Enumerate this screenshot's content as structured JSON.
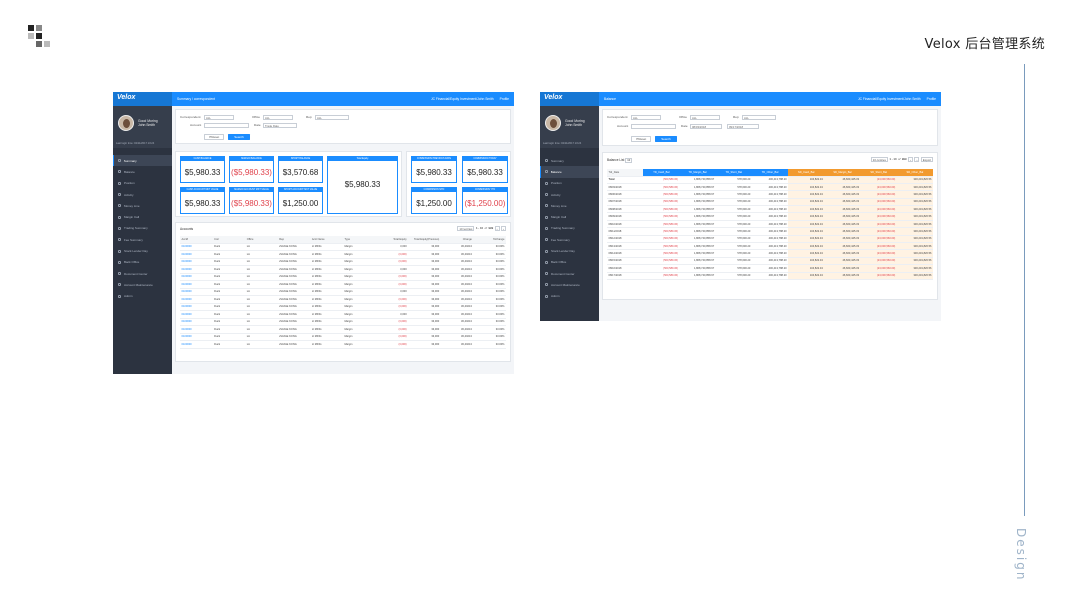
{
  "page": {
    "title": "Velox 后台管理系统",
    "side_label": "Design"
  },
  "left": {
    "brand": "Velox",
    "user": {
      "greeting": "Good Moring",
      "name": "John Smith",
      "last_login": "Last login time: 02/11/2017 13:24"
    },
    "breadcrumb": "Summary  /  correspondent",
    "account_label": "JC Financial/Equity Investment/John Smith",
    "profile_label": "Profile",
    "menu": [
      "Summary",
      "Balance",
      "Position",
      "Activity",
      "Money Line",
      "Margin Call",
      "Trading Summary",
      "Fee Summary",
      "Stock Lender Day",
      "Back Office",
      "Document Center",
      "Account Maintenance",
      "Admin"
    ],
    "filters": {
      "correspondent_label": "Correspondent",
      "correspondent_value": "ALL",
      "office_label": "Office",
      "office_value": "ALL",
      "rep_label": "Rep",
      "rep_value": "ALL",
      "account_label": "Account",
      "date_label": "Date",
      "date_value": "Trade Date",
      "reset": "Reset",
      "search": "Search"
    },
    "kpis": {
      "cash_balance": {
        "label": "CASH BALANCE",
        "value": "$5,980.33"
      },
      "margin_balance": {
        "label": "MARGIN BALANCE",
        "value": "($5,980.33)"
      },
      "short_balance": {
        "label": "SHORT BALANCE",
        "value": "$3,570.68"
      },
      "total_equity": {
        "label": "Total Equity",
        "value": "$5,980.33"
      },
      "cash_mkt": {
        "label": "CASH ACCOUNT MKT VALUE",
        "value": "$5,980.33"
      },
      "margin_mkt": {
        "label": "MARGIN ACCOUNT MKT VALUE",
        "value": "($5,980.33)"
      },
      "short_mkt": {
        "label": "SHORT ACCOUNT MKT VALUE",
        "value": "$1,250.00"
      },
      "commission_prev": {
        "label": "COMMISSION PREVIOUS DATE",
        "value": "$5,980.33"
      },
      "commission_today": {
        "label": "COMMISSION TODAY",
        "value": "$5,980.33"
      },
      "commission_a": {
        "label": "COMMISSION MTD",
        "value": "$1,250.00"
      },
      "commission_b": {
        "label": "COMMISSION YTD",
        "value": "($1,250.00)"
      }
    },
    "accounts": {
      "title": "Accounts",
      "pager": {
        "per_page": "10 /entries",
        "range": "1 - 10",
        "of": "of",
        "total": "999"
      },
      "columns": [
        "Acct#",
        "Corr",
        "Office",
        "Rep",
        "Acct Name",
        "Type",
        "Total Equity",
        "Total Equity(Previous)",
        "Change",
        "%Change"
      ],
      "rows": [
        [
          "0100000",
          "Duck",
          "LA",
          "ZHUGE KONG",
          "LI MING",
          "Margin",
          "3,000",
          "33,000",
          "30,40213",
          "33.00%"
        ],
        [
          "0100000",
          "Duck",
          "LA",
          "ZHUGE KONG",
          "LI MING",
          "Margin",
          "(3,000)",
          "33,000",
          "30,40213",
          "33.00%"
        ],
        [
          "0100000",
          "Duck",
          "LA",
          "ZHUGE KONG",
          "LI MING",
          "Margin",
          "(3,000)",
          "33,000",
          "30,40213",
          "33.00%"
        ],
        [
          "0100000",
          "Duck",
          "LA",
          "ZHUGE KONG",
          "LI MING",
          "Margin",
          "3,000",
          "33,000",
          "30,40213",
          "33.00%"
        ],
        [
          "0100000",
          "Duck",
          "LA",
          "ZHUGE KONG",
          "LI MING",
          "Margin",
          "(3,000)",
          "33,000",
          "30,40213",
          "33.00%"
        ],
        [
          "0100000",
          "Duck",
          "LA",
          "ZHUGE KONG",
          "LI MING",
          "Margin",
          "(3,000)",
          "33,000",
          "30,40213",
          "33.00%"
        ],
        [
          "0100000",
          "Duck",
          "LA",
          "ZHUGE KONG",
          "LI MING",
          "Margin",
          "3,000",
          "33,000",
          "30,40213",
          "33.00%"
        ],
        [
          "0100000",
          "Duck",
          "LA",
          "ZHUGE KONG",
          "LI MING",
          "Margin",
          "(3,000)",
          "33,000",
          "30,40213",
          "33.00%"
        ],
        [
          "0100000",
          "Duck",
          "LA",
          "ZHUGE KONG",
          "LI MING",
          "Margin",
          "(3,000)",
          "33,000",
          "30,40213",
          "33.00%"
        ],
        [
          "0100000",
          "Duck",
          "LA",
          "ZHUGE KONG",
          "LI MING",
          "Margin",
          "3,000",
          "33,000",
          "30,40213",
          "33.00%"
        ],
        [
          "0100000",
          "Duck",
          "LA",
          "ZHUGE KONG",
          "LI MING",
          "Margin",
          "(3,000)",
          "33,000",
          "30,40213",
          "33.00%"
        ],
        [
          "0100000",
          "Duck",
          "LA",
          "ZHUGE KONG",
          "LI MING",
          "Margin",
          "(3,000)",
          "33,000",
          "30,40213",
          "33.00%"
        ],
        [
          "0100000",
          "Duck",
          "LA",
          "ZHUGE KONG",
          "LI MING",
          "Margin",
          "(3,000)",
          "33,000",
          "30,40213",
          "33.00%"
        ],
        [
          "0100000",
          "Duck",
          "LA",
          "ZHUGE KONG",
          "LI MING",
          "Margin",
          "(3,000)",
          "33,000",
          "30,40213",
          "33.00%"
        ]
      ]
    }
  },
  "right": {
    "brand": "Velox",
    "user": {
      "greeting": "Good Moring",
      "name": "John Smith",
      "last_login": "Last login time: 02/11/2017 13:24"
    },
    "breadcrumb": "Balance",
    "account_label": "JC Financial/Equity Investment/John Smith",
    "profile_label": "Profile",
    "menu": [
      "Summary",
      "Balance",
      "Position",
      "Activity",
      "Money Line",
      "Margin Call",
      "Trading Summary",
      "Fee Summary",
      "Stock Lender Day",
      "Back Office",
      "Document Center",
      "Account Maintenance",
      "Admin"
    ],
    "filters": {
      "correspondent_label": "Correspondent",
      "correspondent_value": "ALL",
      "office_label": "Office",
      "office_value": "ALL",
      "rep_label": "Rep",
      "rep_value": "ALL",
      "account_label": "Account",
      "date_label": "Date",
      "date_from": "08/03/2018",
      "date_to": "09/17/2018",
      "reset": "Reset",
      "search": "Search"
    },
    "balance": {
      "title": "Balance List",
      "badge": "10",
      "pager": {
        "per_page": "10 /entries",
        "range": "1 - 10",
        "of": "of",
        "total": "999"
      },
      "export": "Export",
      "columns": [
        "Ttd_Date",
        "TD_Cash_Bal",
        "TD_Margin_Bal",
        "TD_Short_Bal",
        "TD_Other_Bal",
        "SD_Cash_Bal",
        "SD_Margin_Bal",
        "SD_Short_Bal",
        "SD_Other_Bal"
      ],
      "rows": [
        [
          "Total",
          "(560,589.36)",
          "1,868,740,858.97",
          "578,600.20",
          "400,413,788.20",
          "104,822.34",
          "46,660,445.33",
          "(23,000,560.00)",
          "330,219,820.56"
        ],
        [
          "08/03/2018",
          "(560,589.36)",
          "1,868,740,858.97",
          "578,600.20",
          "400,413,788.20",
          "104,822.34",
          "46,660,445.33",
          "(23,000,560.00)",
          "330,219,820.56"
        ],
        [
          "08/06/2018",
          "(560,589.36)",
          "1,868,740,858.97",
          "578,600.20",
          "400,413,788.20",
          "104,822.34",
          "46,660,445.33",
          "(23,000,560.00)",
          "330,219,820.56"
        ],
        [
          "08/07/2018",
          "(560,589.36)",
          "1,868,740,858.97",
          "578,600.20",
          "400,413,788.20",
          "104,822.34",
          "46,660,445.33",
          "(23,000,560.00)",
          "330,219,820.56"
        ],
        [
          "08/08/2018",
          "(560,589.36)",
          "1,868,740,858.97",
          "578,600.20",
          "400,413,788.20",
          "104,822.34",
          "46,660,445.33",
          "(23,000,560.00)",
          "330,219,820.56"
        ],
        [
          "08/09/2018",
          "(560,589.36)",
          "1,868,740,858.97",
          "578,600.20",
          "400,413,788.20",
          "104,822.34",
          "46,660,445.33",
          "(23,000,560.00)",
          "330,219,820.56"
        ],
        [
          "08/10/2018",
          "(560,589.36)",
          "1,868,740,858.97",
          "578,600.20",
          "400,413,788.20",
          "104,822.34",
          "46,660,445.33",
          "(23,000,560.00)",
          "330,219,820.56"
        ],
        [
          "08/11/2018",
          "(560,589.36)",
          "1,868,740,858.97",
          "578,600.20",
          "400,413,788.20",
          "104,822.34",
          "46,660,445.33",
          "(23,000,560.00)",
          "330,219,820.56"
        ],
        [
          "08/12/2018",
          "(560,589.36)",
          "1,868,740,858.97",
          "578,600.20",
          "400,413,788.20",
          "104,822.34",
          "46,660,445.33",
          "(23,000,560.00)",
          "330,219,820.56"
        ],
        [
          "08/13/2018",
          "(560,589.36)",
          "1,868,740,858.97",
          "578,600.20",
          "400,413,788.20",
          "104,822.34",
          "46,660,445.33",
          "(23,000,560.00)",
          "330,219,820.56"
        ],
        [
          "08/14/2018",
          "(560,589.36)",
          "1,868,740,858.97",
          "578,600.20",
          "400,413,788.20",
          "104,822.34",
          "46,660,445.33",
          "(23,000,560.00)",
          "330,219,820.56"
        ],
        [
          "08/15/2018",
          "(560,589.36)",
          "1,868,740,858.97",
          "578,600.20",
          "400,413,788.20",
          "104,822.34",
          "46,660,445.33",
          "(23,000,560.00)",
          "330,219,820.56"
        ],
        [
          "08/16/2018",
          "(560,589.36)",
          "1,868,740,858.97",
          "578,600.20",
          "400,413,788.20",
          "104,822.34",
          "46,660,445.33",
          "(23,000,560.00)",
          "330,219,820.56"
        ],
        [
          "08/17/2018",
          "(560,589.36)",
          "1,868,740,858.97",
          "578,600.20",
          "400,413,788.20",
          "104,822.34",
          "46,660,445.33",
          "(23,000,560.00)",
          "330,219,820.56"
        ]
      ]
    }
  }
}
